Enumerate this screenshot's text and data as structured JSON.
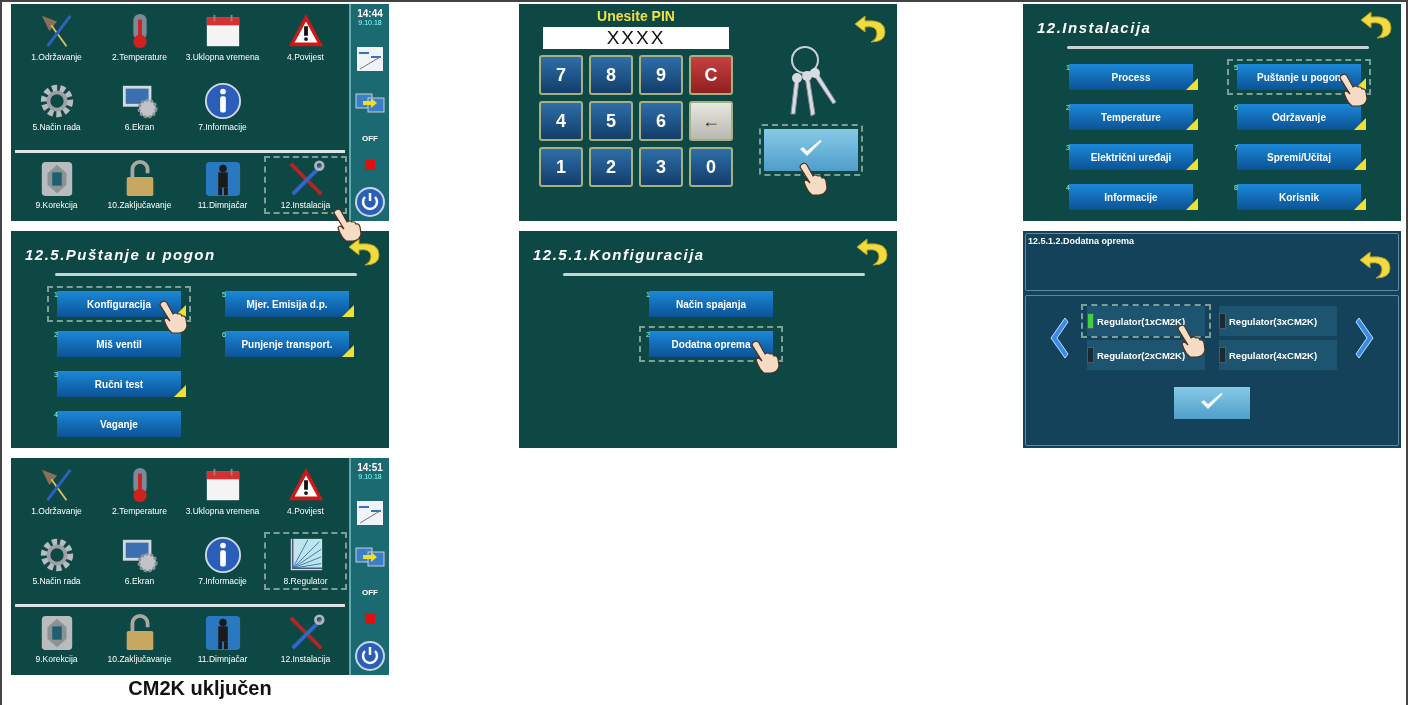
{
  "screens": [
    {
      "kind": "main_menu",
      "clock": {
        "time": "14:44",
        "date": "9.10.18"
      },
      "power_state": "OFF",
      "top_items": [
        {
          "label": "1.Održavanje",
          "selected": false,
          "pointer": false
        },
        {
          "label": "2.Temperature",
          "selected": false,
          "pointer": false
        },
        {
          "label": "3.Uklopna vremena",
          "selected": false,
          "pointer": false
        },
        {
          "label": "4.Povijest",
          "selected": false,
          "pointer": false
        },
        {
          "label": "5.Način rada",
          "selected": false,
          "pointer": false
        },
        {
          "label": "6.Ekran",
          "selected": false,
          "pointer": false
        },
        {
          "label": "7.Informacije",
          "selected": false,
          "pointer": false
        }
      ],
      "bottom_items": [
        {
          "label": "9.Korekcija",
          "selected": false,
          "pointer": false
        },
        {
          "label": "10.Zaključavanje",
          "selected": false,
          "pointer": false
        },
        {
          "label": "11.Dimnjačar",
          "selected": false,
          "pointer": false
        },
        {
          "label": "12.Instalacija",
          "selected": true,
          "pointer": true
        }
      ]
    },
    {
      "kind": "pin",
      "title": "Unesite PIN",
      "value": "XXXX",
      "keys": [
        {
          "label": "7",
          "kind": "digit"
        },
        {
          "label": "8",
          "kind": "digit"
        },
        {
          "label": "9",
          "kind": "digit"
        },
        {
          "label": "C",
          "kind": "clear"
        },
        {
          "label": "4",
          "kind": "digit"
        },
        {
          "label": "5",
          "kind": "digit"
        },
        {
          "label": "6",
          "kind": "digit"
        },
        {
          "label": "←",
          "kind": "back"
        },
        {
          "label": "1",
          "kind": "digit"
        },
        {
          "label": "2",
          "kind": "digit"
        },
        {
          "label": "3",
          "kind": "digit"
        },
        {
          "label": "0",
          "kind": "digit"
        }
      ],
      "confirm": {
        "selected": true,
        "pointer": true
      }
    },
    {
      "kind": "menu",
      "title": "12.Instalacija",
      "columns": [
        [
          {
            "number": "1",
            "label": "Process",
            "submenu": true,
            "selected": false,
            "pointer": false
          },
          {
            "number": "2",
            "label": "Temperature",
            "submenu": true,
            "selected": false,
            "pointer": false
          },
          {
            "number": "3",
            "label": "Električni uređaji",
            "submenu": true,
            "selected": false,
            "pointer": false
          },
          {
            "number": "4",
            "label": "Informacije",
            "submenu": true,
            "selected": false,
            "pointer": false
          }
        ],
        [
          {
            "number": "5",
            "label": "Puštanje u pogon",
            "submenu": true,
            "selected": true,
            "pointer": true
          },
          {
            "number": "6",
            "label": "Održavanje",
            "submenu": true,
            "selected": false,
            "pointer": false
          },
          {
            "number": "7",
            "label": "Spremi/Učitaj",
            "submenu": true,
            "selected": false,
            "pointer": false
          },
          {
            "number": "8",
            "label": "Korisnik",
            "submenu": true,
            "selected": false,
            "pointer": false
          }
        ]
      ]
    },
    {
      "kind": "menu",
      "title": "12.5.Puštanje u pogon",
      "columns": [
        [
          {
            "number": "1",
            "label": "Konfiguracija",
            "submenu": true,
            "selected": true,
            "pointer": true
          },
          {
            "number": "2",
            "label": "Miš ventil",
            "submenu": false,
            "selected": false,
            "pointer": false
          },
          {
            "number": "3",
            "label": "Ručni test",
            "submenu": true,
            "selected": false,
            "pointer": false
          },
          {
            "number": "4",
            "label": "Vaganje",
            "submenu": false,
            "selected": false,
            "pointer": false
          }
        ],
        [
          {
            "number": "5",
            "label": "Mjer. Emisija d.p.",
            "submenu": true,
            "selected": false,
            "pointer": false
          },
          {
            "number": "6",
            "label": "Punjenje transport.",
            "submenu": true,
            "selected": false,
            "pointer": false
          }
        ]
      ]
    },
    {
      "kind": "menu",
      "title": "12.5.1.Konfiguracija",
      "columns": [
        [
          {
            "number": "1",
            "label": "Način spajanja",
            "submenu": false,
            "selected": false,
            "pointer": false
          },
          {
            "number": "2",
            "label": "Dodatna oprema",
            "submenu": false,
            "selected": true,
            "pointer": true
          }
        ]
      ]
    },
    {
      "kind": "options",
      "title": "12.5.1.2.Dodatna oprema",
      "options": [
        {
          "label": "Regulator(1xCM2K)",
          "checked": true,
          "selected": true,
          "pointer": true
        },
        {
          "label": "Regulator(3xCM2K)",
          "checked": false,
          "selected": false,
          "pointer": false
        },
        {
          "label": "Regulator(2xCM2K)",
          "checked": false,
          "selected": false,
          "pointer": false
        },
        {
          "label": "Regulator(4xCM2K)",
          "checked": false,
          "selected": false,
          "pointer": false
        }
      ],
      "confirm": {
        "selected": false,
        "pointer": false
      }
    },
    {
      "kind": "main_menu",
      "clock": {
        "time": "14:51",
        "date": "9.10.18"
      },
      "power_state": "OFF",
      "caption": "CM2K uključen",
      "top_items": [
        {
          "label": "1.Održavanje",
          "selected": false,
          "pointer": false
        },
        {
          "label": "2.Temperature",
          "selected": false,
          "pointer": false
        },
        {
          "label": "3.Uklopna vremena",
          "selected": false,
          "pointer": false
        },
        {
          "label": "4.Povijest",
          "selected": false,
          "pointer": false
        },
        {
          "label": "5.Način rada",
          "selected": false,
          "pointer": false
        },
        {
          "label": "6.Ekran",
          "selected": false,
          "pointer": false
        },
        {
          "label": "7.Informacije",
          "selected": false,
          "pointer": false
        },
        {
          "label": "8.Regulator",
          "selected": true,
          "pointer": false
        }
      ],
      "bottom_items": [
        {
          "label": "9.Korekcija",
          "selected": false,
          "pointer": false
        },
        {
          "label": "10.Zaključavanje",
          "selected": false,
          "pointer": false
        },
        {
          "label": "11.Dimnjačar",
          "selected": false,
          "pointer": false
        },
        {
          "label": "12.Instalacija",
          "selected": false,
          "pointer": false
        }
      ]
    }
  ]
}
